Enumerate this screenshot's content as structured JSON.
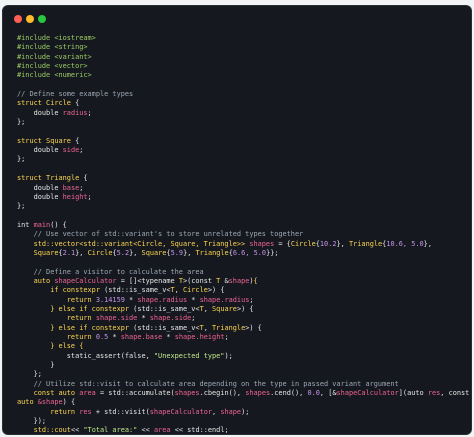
{
  "colors": {
    "background": "#15191f",
    "default": "#e6e6e6",
    "preprocessor": "#9ccc65",
    "comment": "#9ea7b4",
    "keyword": "#ffd54f",
    "type": "#ffd54f",
    "member": "#f06292",
    "number": "#c792ea",
    "string": "#c3e88d",
    "dot_red": "#ff5f56",
    "dot_yellow": "#ffbd2e",
    "dot_green": "#27c93f"
  },
  "window": {
    "controls": [
      "close-dot",
      "minimize-dot",
      "zoom-dot"
    ]
  },
  "code": {
    "lines": [
      [
        [
          "#include <iostream>",
          "preprocessor"
        ]
      ],
      [
        [
          "#include <string>",
          "preprocessor"
        ]
      ],
      [
        [
          "#include <variant>",
          "preprocessor"
        ]
      ],
      [
        [
          "#include <vector>",
          "preprocessor"
        ]
      ],
      [
        [
          "#include <numeric>",
          "preprocessor"
        ]
      ],
      [],
      [
        [
          "// Define some example types",
          "comment"
        ]
      ],
      [
        [
          "struct ",
          "keyword"
        ],
        [
          "Circle",
          "type"
        ],
        [
          " {",
          "default"
        ]
      ],
      [
        [
          "    double ",
          "default"
        ],
        [
          "radius",
          "member"
        ],
        [
          ";",
          "default"
        ]
      ],
      [
        [
          "};",
          "default"
        ]
      ],
      [],
      [
        [
          "struct ",
          "keyword"
        ],
        [
          "Square",
          "type"
        ],
        [
          " {",
          "default"
        ]
      ],
      [
        [
          "    double ",
          "default"
        ],
        [
          "side",
          "member"
        ],
        [
          ";",
          "default"
        ]
      ],
      [
        [
          "};",
          "default"
        ]
      ],
      [],
      [
        [
          "struct ",
          "keyword"
        ],
        [
          "Triangle",
          "type"
        ],
        [
          " {",
          "default"
        ]
      ],
      [
        [
          "    double ",
          "default"
        ],
        [
          "base",
          "member"
        ],
        [
          ";",
          "default"
        ]
      ],
      [
        [
          "    double ",
          "default"
        ],
        [
          "height",
          "member"
        ],
        [
          ";",
          "default"
        ]
      ],
      [
        [
          "};",
          "default"
        ]
      ],
      [],
      [
        [
          "int ",
          "default"
        ],
        [
          "main",
          "member"
        ],
        [
          "() {",
          "default"
        ]
      ],
      [
        [
          "    // Use vector of std::variant's to store unrelated types together",
          "comment"
        ]
      ],
      [
        [
          "    std::vector<std::variant<Circle, Square, Triangle>> ",
          "keyword"
        ],
        [
          "shapes",
          "member"
        ],
        [
          " = {",
          "default"
        ],
        [
          "Circle",
          "type"
        ],
        [
          "{",
          "default"
        ],
        [
          "10.2",
          "number"
        ],
        [
          "}, ",
          "default"
        ],
        [
          "Triangle",
          "type"
        ],
        [
          "{",
          "default"
        ],
        [
          "10.6, 5.0",
          "number"
        ],
        [
          "},",
          "default"
        ]
      ],
      [
        [
          "    ",
          "default"
        ],
        [
          "Square",
          "type"
        ],
        [
          "{",
          "default"
        ],
        [
          "2.1",
          "number"
        ],
        [
          "}, ",
          "default"
        ],
        [
          "Circle",
          "type"
        ],
        [
          "{",
          "default"
        ],
        [
          "5.2",
          "number"
        ],
        [
          "}, ",
          "default"
        ],
        [
          "Square",
          "type"
        ],
        [
          "{",
          "default"
        ],
        [
          "5.9",
          "number"
        ],
        [
          "}, ",
          "default"
        ],
        [
          "Triangle",
          "type"
        ],
        [
          "{",
          "default"
        ],
        [
          "6.6, 5.0",
          "number"
        ],
        [
          "}};",
          "default"
        ]
      ],
      [],
      [
        [
          "    // Define a visitor to calculate the area",
          "comment"
        ]
      ],
      [
        [
          "    auto ",
          "keyword"
        ],
        [
          "shapeCalculator",
          "member"
        ],
        [
          " = []<typename ",
          "default"
        ],
        [
          "T",
          "type"
        ],
        [
          ">(const ",
          "default"
        ],
        [
          "T",
          "type"
        ],
        [
          " &",
          "default"
        ],
        [
          "shape",
          "member"
        ],
        [
          ")",
          "default"
        ],
        [
          "{",
          "keyword"
        ]
      ],
      [
        [
          "        if constexpr ",
          "keyword"
        ],
        [
          "(std::is_same_v<",
          "default"
        ],
        [
          "T",
          "type"
        ],
        [
          ", ",
          "default"
        ],
        [
          "Circle",
          "type"
        ],
        [
          ">) {",
          "default"
        ]
      ],
      [
        [
          "            return ",
          "keyword"
        ],
        [
          "3.14159 ",
          "number"
        ],
        [
          "* ",
          "default"
        ],
        [
          "shape.radius",
          "member"
        ],
        [
          " * ",
          "default"
        ],
        [
          "shape.radius",
          "member"
        ],
        [
          ";",
          "default"
        ]
      ],
      [
        [
          "        } else if constexpr ",
          "keyword"
        ],
        [
          "(std::is_same_v<",
          "default"
        ],
        [
          "T",
          "type"
        ],
        [
          ", ",
          "default"
        ],
        [
          "Square",
          "type"
        ],
        [
          ">) {",
          "default"
        ]
      ],
      [
        [
          "            return ",
          "keyword"
        ],
        [
          "shape.side",
          "member"
        ],
        [
          " * ",
          "default"
        ],
        [
          "shape.side",
          "member"
        ],
        [
          ";",
          "default"
        ]
      ],
      [
        [
          "        } else if constexpr ",
          "keyword"
        ],
        [
          "(std::is_same_v<",
          "default"
        ],
        [
          "T",
          "type"
        ],
        [
          ", ",
          "default"
        ],
        [
          "Triangle",
          "type"
        ],
        [
          ">) {",
          "default"
        ]
      ],
      [
        [
          "            return ",
          "keyword"
        ],
        [
          "0.5 ",
          "number"
        ],
        [
          "* ",
          "default"
        ],
        [
          "shape.base",
          "member"
        ],
        [
          " * ",
          "default"
        ],
        [
          "shape.height",
          "member"
        ],
        [
          ";",
          "default"
        ]
      ],
      [
        [
          "        } else {",
          "keyword"
        ]
      ],
      [
        [
          "            static_assert(false, ",
          "default"
        ],
        [
          "\"Unexpected type\"",
          "string"
        ],
        [
          ");",
          "default"
        ]
      ],
      [
        [
          "        }",
          "default"
        ]
      ],
      [
        [
          "    };",
          "default"
        ]
      ],
      [
        [
          "    // Utilize std::visit to calculate area depending on the type in passed variant argument",
          "comment"
        ]
      ],
      [
        [
          "    const auto ",
          "keyword"
        ],
        [
          "area",
          "member"
        ],
        [
          " = std::accumulate(",
          "default"
        ],
        [
          "shapes",
          "member"
        ],
        [
          ".cbegin(), ",
          "default"
        ],
        [
          "shapes",
          "member"
        ],
        [
          ".cend(), ",
          "default"
        ],
        [
          "0.0",
          "number"
        ],
        [
          ", [&",
          "default"
        ],
        [
          "shapeCalculator",
          "member"
        ],
        [
          "](auto ",
          "default"
        ],
        [
          "res",
          "member"
        ],
        [
          ", const",
          "default"
        ]
      ],
      [
        [
          "auto ",
          "keyword"
        ],
        [
          "&shape",
          "member"
        ],
        [
          ") {",
          "default"
        ]
      ],
      [
        [
          "        return ",
          "keyword"
        ],
        [
          "res",
          "member"
        ],
        [
          " + std::visit(",
          "default"
        ],
        [
          "shapeCalculator",
          "member"
        ],
        [
          ", ",
          "default"
        ],
        [
          "shape",
          "member"
        ],
        [
          ");",
          "default"
        ]
      ],
      [
        [
          "    });",
          "default"
        ]
      ],
      [
        [
          "    std::cout",
          "keyword"
        ],
        [
          "<< ",
          "default"
        ],
        [
          "\"Total area:\"",
          "string"
        ],
        [
          " << ",
          "default"
        ],
        [
          "area",
          "member"
        ],
        [
          " << std::endl;",
          "default"
        ]
      ],
      [
        [
          "    return ",
          "keyword"
        ],
        [
          "0",
          "number"
        ],
        [
          ";",
          "default"
        ]
      ],
      [
        [
          "}",
          "default"
        ]
      ]
    ]
  }
}
